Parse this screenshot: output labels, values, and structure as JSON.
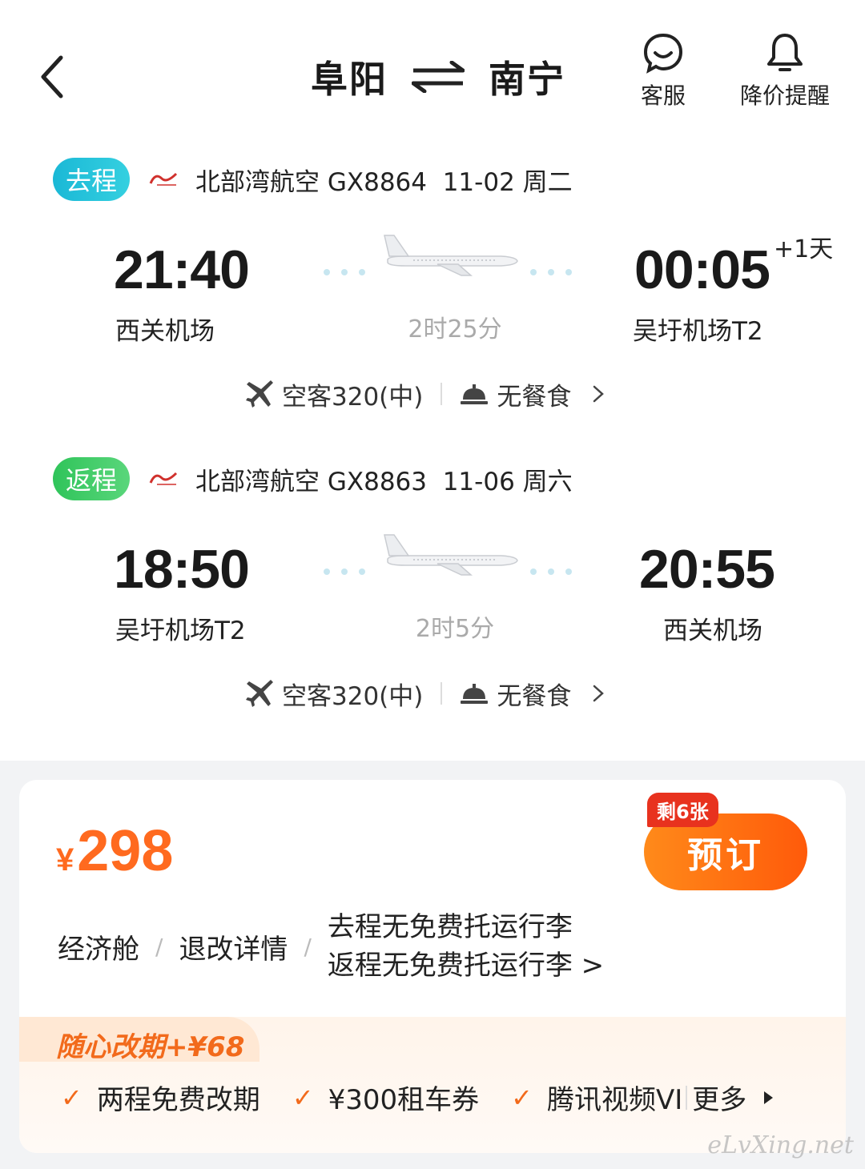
{
  "header": {
    "origin": "阜阳",
    "destination": "南宁",
    "service_label": "客服",
    "price_alert_label": "降价提醒"
  },
  "outbound": {
    "badge": "去程",
    "info": "北部湾航空 GX8864  11-02 周二",
    "dep_time": "21:40",
    "dep_airport": "西关机场",
    "duration": "2时25分",
    "arr_time": "00:05",
    "plus_day": "+1天",
    "arr_airport": "吴圩机场T2",
    "aircraft": "空客320(中)",
    "meal": "无餐食"
  },
  "return": {
    "badge": "返程",
    "info": "北部湾航空 GX8863  11-06 周六",
    "dep_time": "18:50",
    "dep_airport": "吴圩机场T2",
    "duration": "2时5分",
    "arr_time": "20:55",
    "arr_airport": "西关机场",
    "aircraft": "空客320(中)",
    "meal": "无餐食"
  },
  "fare": {
    "currency": "¥",
    "price": "298",
    "seats_left": "剩6张",
    "book_label": "预订",
    "cabin": "经济舱",
    "refund_label": "退改详情",
    "baggage_out": "去程无免费托运行李",
    "baggage_ret": "返程无免费托运行李 >"
  },
  "plus": {
    "title": "随心改期+¥68",
    "benefits": [
      "两程免费改期",
      "¥300租车券",
      "腾讯视频VI"
    ],
    "more_label": "更多"
  },
  "watermark": "eLvXing.net",
  "colors": {
    "accent": "#ff6a1f",
    "badge_out": "#1ab8d6",
    "badge_ret": "#2fc45a",
    "seats_badge": "#e8321e"
  }
}
